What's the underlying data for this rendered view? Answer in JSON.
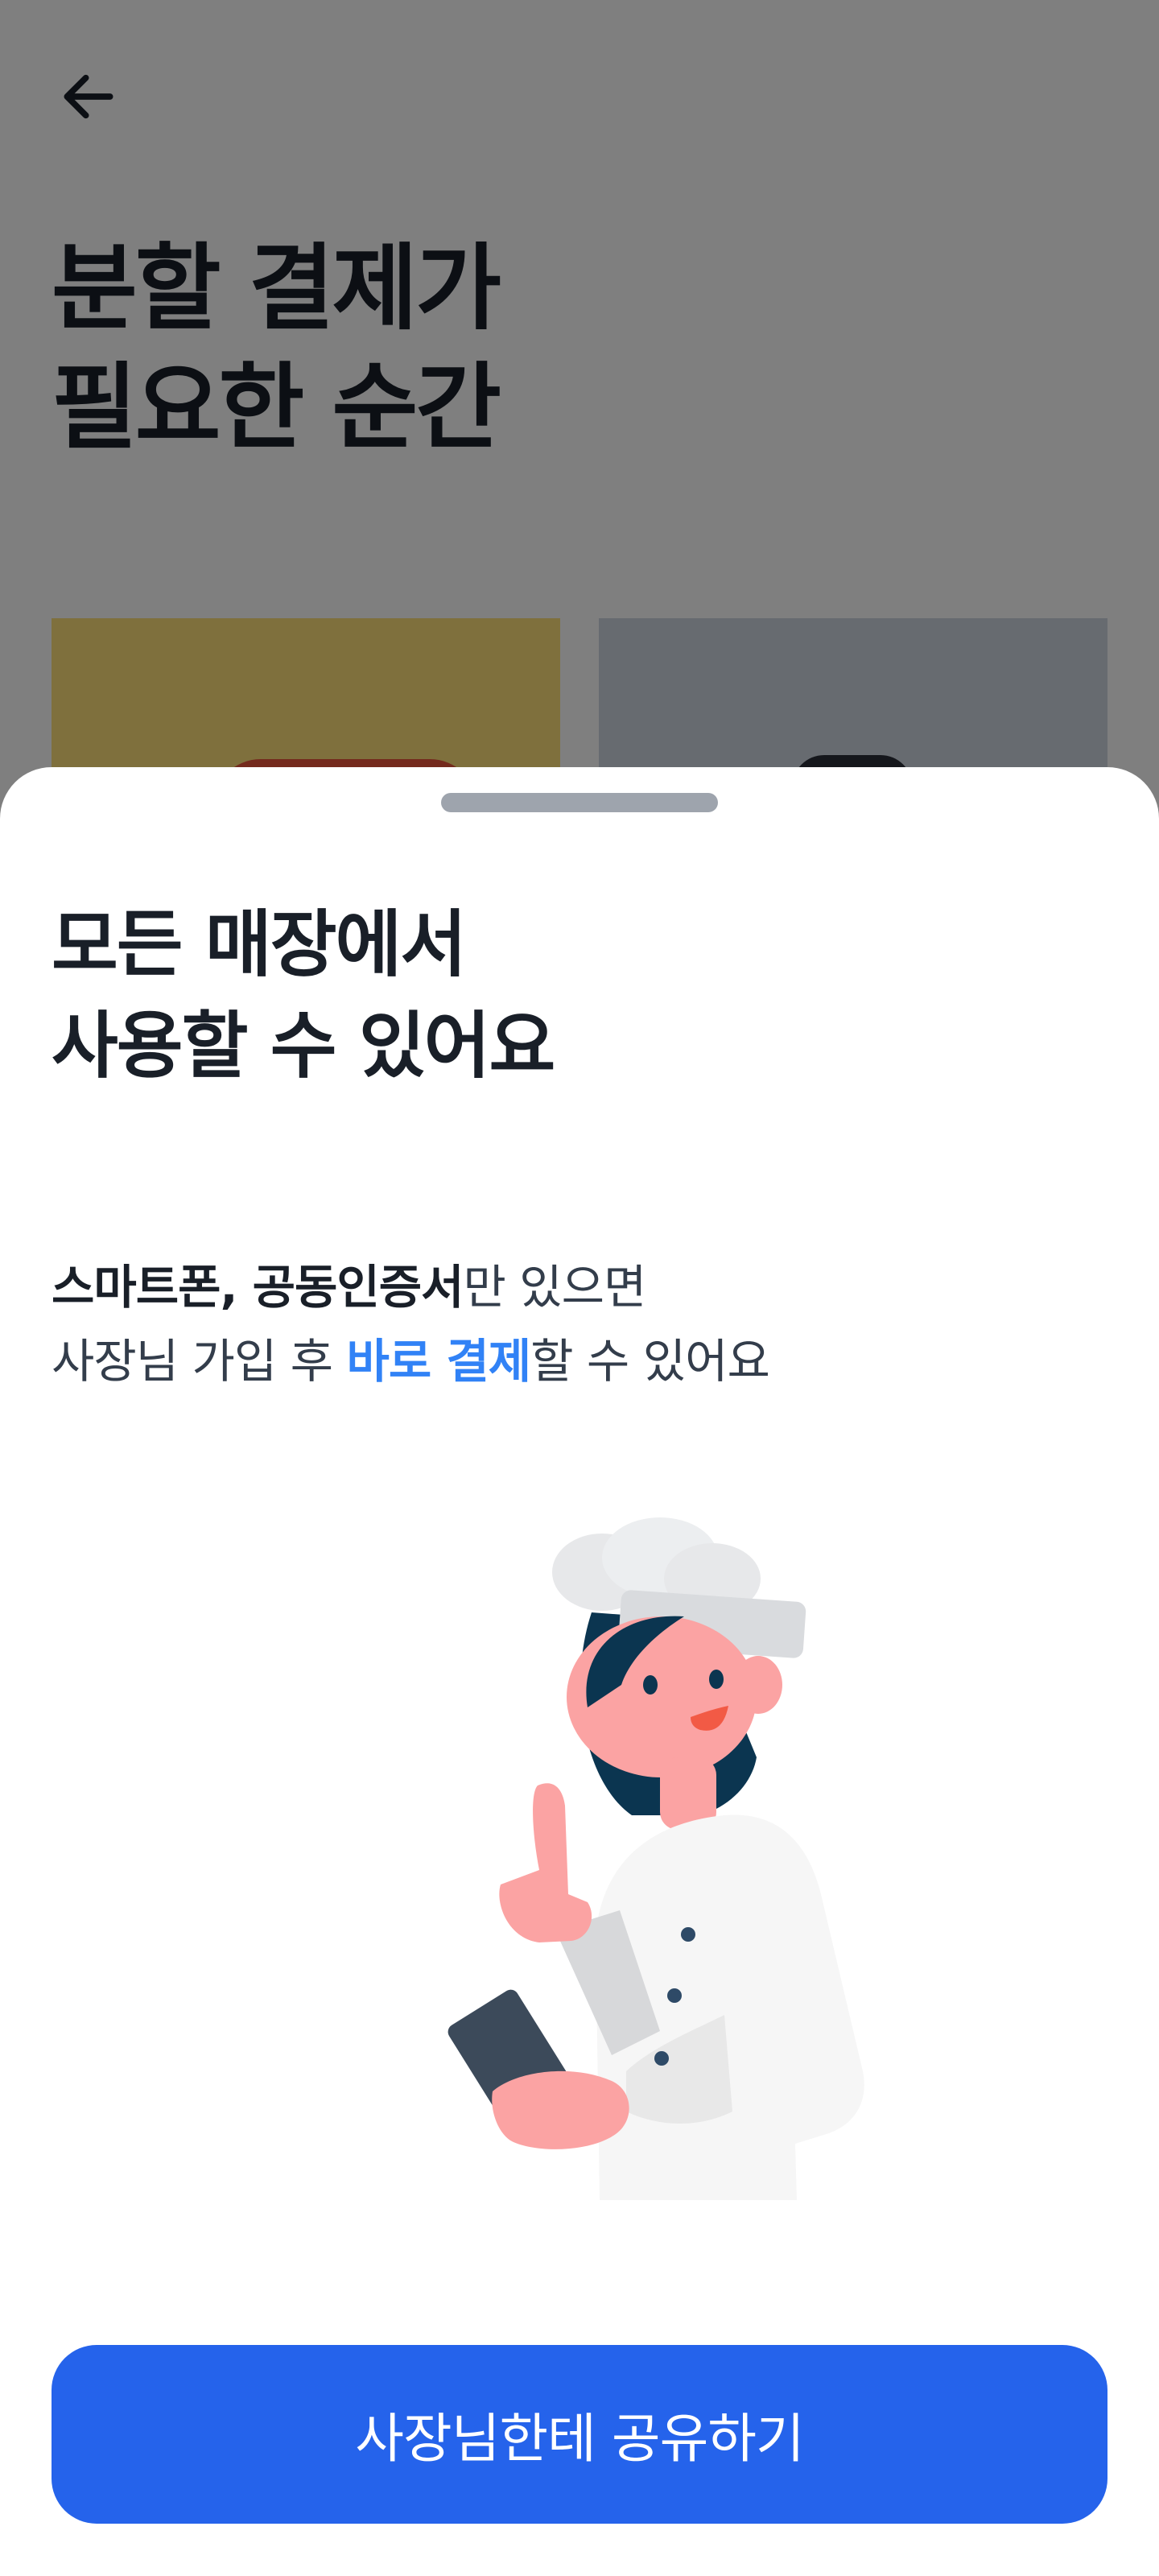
{
  "background_page": {
    "title_line1": "분할 결제가",
    "title_line2": "필요한 순간"
  },
  "sheet": {
    "title_line1": "모든 매장에서",
    "title_line2": "사용할 수 있어요",
    "description": {
      "line1_bold": "스마트폰, 공동인증서",
      "line1_rest": "만 있으면",
      "line2_start": "사장님 가입 후 ",
      "line2_highlight": "바로 결제",
      "line2_end": "할 수 있어요"
    },
    "cta_label": "사장님한테 공유하기"
  },
  "colors": {
    "accent": "#2563eb",
    "highlight": "#3182f6",
    "text_primary": "#191f28",
    "text_secondary": "#333d4b",
    "overlay": "rgba(0,0,0,0.5)"
  },
  "icons": {
    "back": "arrow-left-icon",
    "illustration": "chef-holding-phone-thumbs-up"
  }
}
